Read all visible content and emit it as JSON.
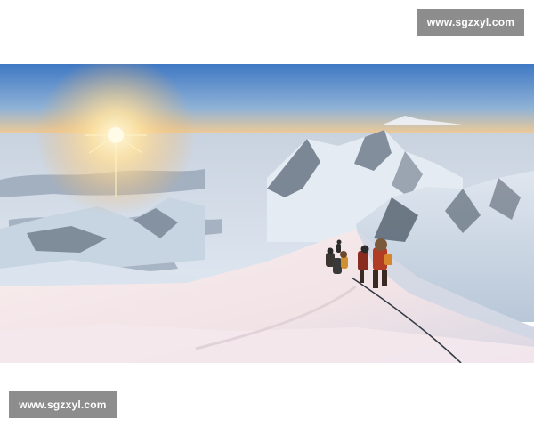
{
  "watermarks": {
    "top_text": "www.sgzxyl.com",
    "bottom_text": "www.sgzxyl.com"
  },
  "photo": {
    "subject": "climbers-on-snowy-ridge-at-sunrise",
    "colors": {
      "sky_top": "#3f78c4",
      "sky_horizon": "#f2b062",
      "sun": "#fff3c8",
      "cloud_sea": "#d7e2ee",
      "snow_light": "#f7ecec",
      "snow_shadow": "#b9c8da",
      "rock": "#4a5663"
    }
  }
}
